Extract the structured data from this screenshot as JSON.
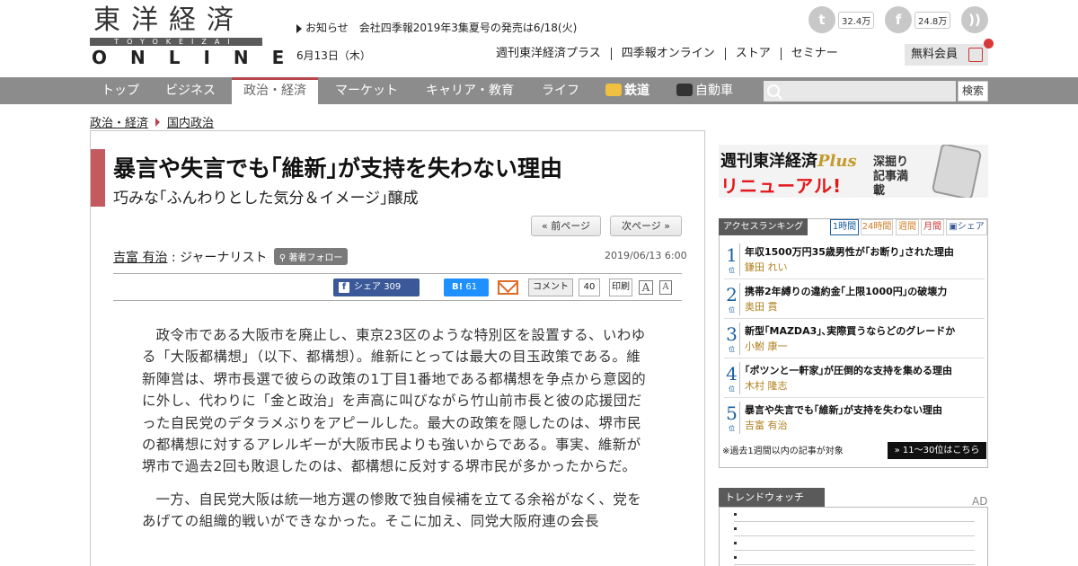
{
  "header": {
    "logo_jp": "東洋経済",
    "logo_roman": "TOYOKEIZAI",
    "logo_online": "ONLINE",
    "notice": "お知らせ　会社四季報2019年3集夏号の発売は6/18(火)",
    "date": "6月13日（木）",
    "twitter_count": "32.4万",
    "facebook_count": "24.8万",
    "sublinks": [
      "週刊東洋経済プラス",
      "四季報オンライン",
      "ストア",
      "セミナー"
    ],
    "member_label": "無料会員"
  },
  "nav": {
    "items": [
      "トップ",
      "ビジネス",
      "政治・経済",
      "マーケット",
      "キャリア・教育",
      "ライフ",
      "鉄道",
      "自動車"
    ],
    "active": "政治・経済",
    "search_placeholder": "",
    "search_button": "検索"
  },
  "breadcrumb": [
    "政治・経済",
    "国内政治"
  ],
  "article": {
    "title": "暴言や失言でも｢維新｣が支持を失わない理由",
    "subtitle": "巧みな｢ふんわりとした気分＆イメージ｣醸成",
    "prev_label": "« 前ページ",
    "next_label": "次ページ »",
    "author_name": "吉富 有治",
    "author_role": " : ジャーナリスト",
    "follow_label": "著者フォロー",
    "pub_date": "2019/06/13 6:00",
    "fb_share_label": "シェア",
    "fb_share_count": "309",
    "hatena_count": "61",
    "comment_label": "コメント",
    "comment_count": "40",
    "print_label": "印刷",
    "font_big": "A",
    "font_small": "A",
    "paragraphs": [
      "政令市である大阪市を廃止し、東京23区のような特別区を設置する、いわゆる「大阪都構想」（以下、都構想）。維新にとっては最大の目玉政策である。維新陣営は、堺市長選で彼らの政策の1丁目1番地である都構想を争点から意図的に外し、代わりに「金と政治」を声高に叫びながら竹山前市長と彼の応援団だった自民党のデタラメぶりをアピールした。最大の政策を隠したのは、堺市民の都構想に対するアレルギーが大阪市民よりも強いからである。事実、維新が堺市で過去2回も敗退したのは、都構想に反対する堺市民が多かったからだ。",
      "一方、自民党大阪は統一地方選の惨敗で独自候補を立てる余裕がなく、党をあげての組織的戦いができなかった。そこに加え、同党大阪府連の会長"
    ]
  },
  "sidebar": {
    "ad": {
      "line1_a": "週刊東洋経済",
      "line1_b": "Plus",
      "line2": "リニューアル!",
      "line3": "深掘り記事満載"
    },
    "ranking": {
      "header": "アクセスランキング",
      "tabs": [
        "1時間",
        "24時間",
        "週間",
        "月間",
        "シェア"
      ],
      "rank_suffix": "位",
      "items": [
        {
          "rank": "1",
          "title": "年収1500万円35歳男性が｢お断り｣された理由",
          "author": "鎌田 れい"
        },
        {
          "rank": "2",
          "title": "携帯2年縛りの違約金｢上限1000円｣の破壊力",
          "author": "奥田 貫"
        },
        {
          "rank": "3",
          "title": "新型｢MAZDA3｣､実際買うならどのグレードか",
          "author": "小鮒 康一"
        },
        {
          "rank": "4",
          "title": "｢ポツンと一軒家｣が圧倒的な支持を集める理由",
          "author": "木村 隆志"
        },
        {
          "rank": "5",
          "title": "暴言や失言でも｢維新｣が支持を失わない理由",
          "author": "吉富 有治"
        }
      ],
      "note": "※過去1週間以内の記事が対象",
      "more_label": "» 11～30位はこちら"
    },
    "trend": {
      "header": "トレンドウォッチ",
      "ad_label": "AD"
    }
  },
  "colors": {
    "accent": "#b8474d",
    "nav_bg": "#8c8c8c",
    "rank_blue": "#1a5f9f",
    "facebook": "#3b5998"
  }
}
